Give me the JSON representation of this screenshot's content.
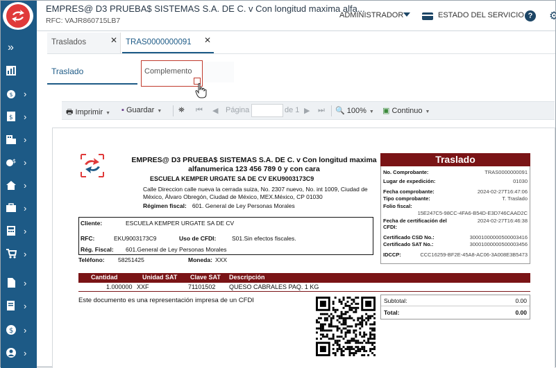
{
  "header": {
    "company": "EMPRES@ D3 PRUEBA$ SISTEMAS S.A. DE C. v Con longitud maxima alfa...",
    "rfc": "RFC: VAJR860715LB7",
    "user_menu": "ADMINISTRADOR",
    "service_status": "ESTADO DEL SERVICIO",
    "help": "?"
  },
  "sidebar": {
    "items": [
      {
        "icon": "dashboard-icon"
      },
      {
        "icon": "coins-icon"
      },
      {
        "icon": "invoice-icon"
      },
      {
        "icon": "building-icon"
      },
      {
        "icon": "money-settings-icon"
      },
      {
        "icon": "home-icon"
      },
      {
        "icon": "briefcase-icon"
      },
      {
        "icon": "calculator-icon"
      },
      {
        "icon": "cart-icon"
      },
      {
        "icon": "document-icon"
      },
      {
        "icon": "receipt-icon"
      },
      {
        "icon": "dollar-icon"
      },
      {
        "icon": "user-icon"
      }
    ]
  },
  "tabs": [
    {
      "label": "Traslados"
    },
    {
      "label": "TRAS0000000091"
    }
  ],
  "subtabs": {
    "traslado": "Traslado",
    "complemento": "Complemento"
  },
  "toolbar": {
    "print": "Imprimir",
    "save": "Guardar",
    "page_label": "Página",
    "page_of": "de 1",
    "zoom": "100%",
    "continuous": "Continuo"
  },
  "document": {
    "issuer_name": "EMPRES@ D3 PRUEBA$ SISTEMAS S.A. DE C. v Con longitud maxima alfanumerica 123 456 789 0 y con cara",
    "receiver_line": "ESCUELA KEMPER URGATE SA DE CV EKU9003173C9",
    "address": "Calle Direccion calle nueva la cerrada suiza, No. 2307 nuevo, No. int 1009, Ciudad de México, Álvaro Obregón, Ciudad de México, MEX.México, CP 01030",
    "regime_label": "Régimen fiscal:",
    "regime_value": "601. General de Ley Personas Morales",
    "client": {
      "client_label": "Cliente:",
      "client_value": "ESCUELA KEMPER URGATE SA DE CV",
      "rfc_label": "RFC:",
      "rfc_value": "EKU9003173C9",
      "cfdi_label": "Uso de CFDI:",
      "cfdi_value": "S01.Sin efectos fiscales.",
      "reg_label": "Rég. Fiscal:",
      "reg_value": "601.General de Ley Personas Morales",
      "phone_label": "Teléfono:",
      "phone_value": "58251425",
      "currency_label": "Moneda:",
      "currency_value": "XXX"
    },
    "summary": {
      "title": "Traslado",
      "rows": [
        {
          "k": "No. Comprobante:",
          "v": "TRAS0000000091"
        },
        {
          "k": "Lugar de expedición:",
          "v": "01030"
        },
        {
          "k": "Fecha comprobante:",
          "v": "2024-02-27T16:47:06"
        },
        {
          "k": "Tipo comprobante:",
          "v": "T. Traslado"
        },
        {
          "k": "Folio fiscal:",
          "v": ""
        },
        {
          "k": "",
          "v": "15E247C5-98CC-4FA6-B54D-E3D746CAAD2C"
        },
        {
          "k": "Fecha de certificación del",
          "v": "2024-02-27T16:46:38"
        },
        {
          "k": "CFDI:",
          "v": ""
        },
        {
          "k": "Certificado CSD No.:",
          "v": "30001000000500003416"
        },
        {
          "k": "Certificado SAT No.:",
          "v": "30001000000500003456"
        },
        {
          "k": "IDCCP:",
          "v": "CCC16259-BF2E-45A8-AC06-3A008E3B5473"
        }
      ]
    },
    "table": {
      "headers": [
        "Cantidad",
        "Unidad SAT",
        "Clave SAT",
        "Descripción"
      ],
      "row": [
        "1.000000",
        "XXF",
        "71101502",
        "QUESO CABRALES PAQ. 1 KG"
      ]
    },
    "footnote": "Este documento es una representación impresa de un CFDI",
    "totals": {
      "subtotal_label": "Subtotal:",
      "subtotal_value": "0.00",
      "total_label": "Total:",
      "total_value": "0.00"
    }
  },
  "colors": {
    "sidebar": "#1d5a86",
    "accent_red": "#7a1416",
    "highlight_red": "#c0392b"
  }
}
